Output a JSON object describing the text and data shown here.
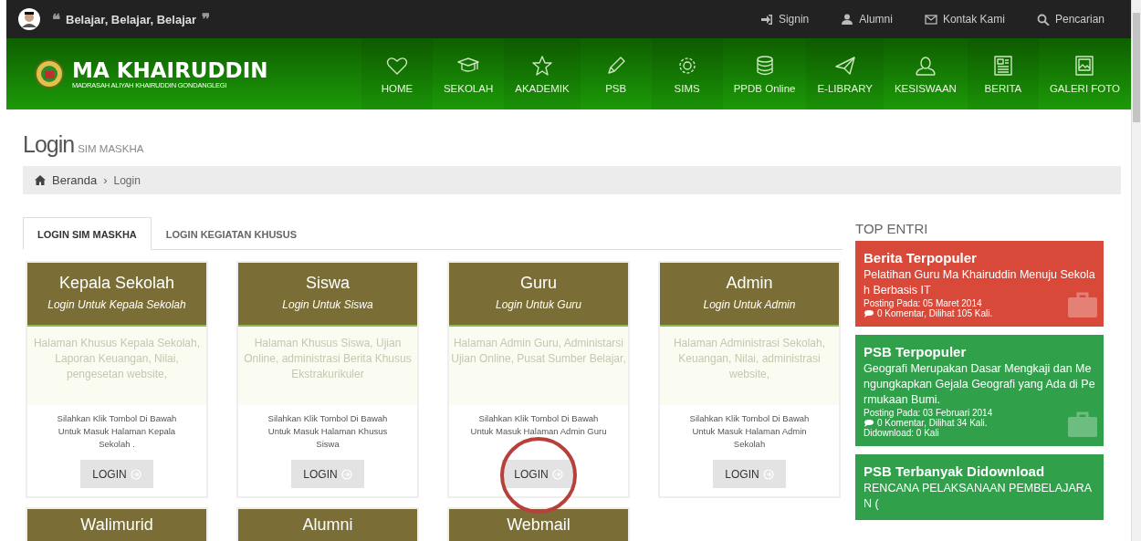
{
  "topbar": {
    "quote_open": "❝",
    "motto": "Belajar, Belajar, Belajar",
    "quote_close": "❞",
    "links": [
      {
        "label": "Signin"
      },
      {
        "label": "Alumni"
      },
      {
        "label": "Kontak Kami"
      },
      {
        "label": "Pencarian"
      }
    ]
  },
  "header": {
    "logo_title": "MA KHAIRUDDIN",
    "logo_subtitle": "MADRASAH ALIYAH KHAIRUDDIN GONDANGLEGI",
    "nav": [
      {
        "label": "HOME"
      },
      {
        "label": "SEKOLAH"
      },
      {
        "label": "AKADEMIK"
      },
      {
        "label": "PSB"
      },
      {
        "label": "SIMS"
      },
      {
        "label": "PPDB Online"
      },
      {
        "label": "E-LIBRARY"
      },
      {
        "label": "KESISWAAN"
      },
      {
        "label": "BERITA"
      },
      {
        "label": "GALERI FOTO"
      }
    ]
  },
  "page_title": "Login",
  "page_subtitle": "SIM MASKHA",
  "breadcrumb": [
    {
      "label": "Beranda"
    },
    {
      "label": "Login"
    }
  ],
  "breadcrumb_separator": "›",
  "tabs": [
    {
      "label": "LOGIN SIM MASKHA",
      "selected": true
    },
    {
      "label": "LOGIN KEGIATAN KHUSUS",
      "selected": false
    }
  ],
  "cards": [
    {
      "title": "Kepala Sekolah",
      "subtitle": "Login Untuk Kepala Sekolah",
      "description": "Halaman Khusus Kepala Sekolah, Laporan Keuangan, Nilai, pengesetan website,",
      "note": "Silahkan Klik Tombol Di Bawah Untuk Masuk Halaman Kepala Sekolah .",
      "button": "LOGIN"
    },
    {
      "title": "Siswa",
      "subtitle": "Login Untuk Siswa",
      "description": "Halaman Khusus Siswa, Ujian Online, administrasi Berita Khusus Ekstrakurikuler",
      "note": "Silahkan Klik Tombol Di Bawah Untuk Masuk Halaman Khusus Siswa",
      "button": "LOGIN"
    },
    {
      "title": "Guru",
      "subtitle": "Login Untuk Guru",
      "description": "Halaman Admin Guru, Administarsi Ujian Online, Pusat Sumber Belajar,",
      "note": "Silahkan Klik Tombol Di Bawah Untuk Masuk Halaman Admin Guru",
      "button": "LOGIN"
    },
    {
      "title": "Admin",
      "subtitle": "Login Untuk Admin",
      "description": "Halaman Administrasi Sekolah, Keuangan, Nilai, administrasi website,",
      "note": "Silahkan Klik Tombol Di Bawah Untuk Masuk Halaman Admin Sekolah",
      "button": "LOGIN"
    },
    {
      "title": "Walimurid"
    },
    {
      "title": "Alumni"
    },
    {
      "title": "Webmail"
    }
  ],
  "sidebar": {
    "title": "TOP ENTRI",
    "entries": [
      {
        "title": "Berita Terpopuler",
        "color": "#d9493a",
        "text": "Pelatihan Guru Ma Khairuddin Menuju Sekolah Berbasis IT",
        "posted": "Posting Pada: 05 Maret 2014",
        "stats": "0 Komentar, Dilihat 105 Kali."
      },
      {
        "title": "PSB Terpopuler",
        "color": "#30a14a",
        "text": "Geografi Merupakan Dasar Mengkaji dan Mengungkapkan Gejala Geografi yang Ada di Permukaan Bumi.",
        "posted": "Posting Pada: 03 Februari 2014",
        "stats": "0 Komentar, Dilihat 34 Kali.",
        "downloads": "Didownload: 0 Kali"
      },
      {
        "title": "PSB Terbanyak Didownload",
        "color": "#30a14a",
        "text": "RENCANA PELAKSANAAN PEMBELAJARAN ("
      }
    ]
  }
}
